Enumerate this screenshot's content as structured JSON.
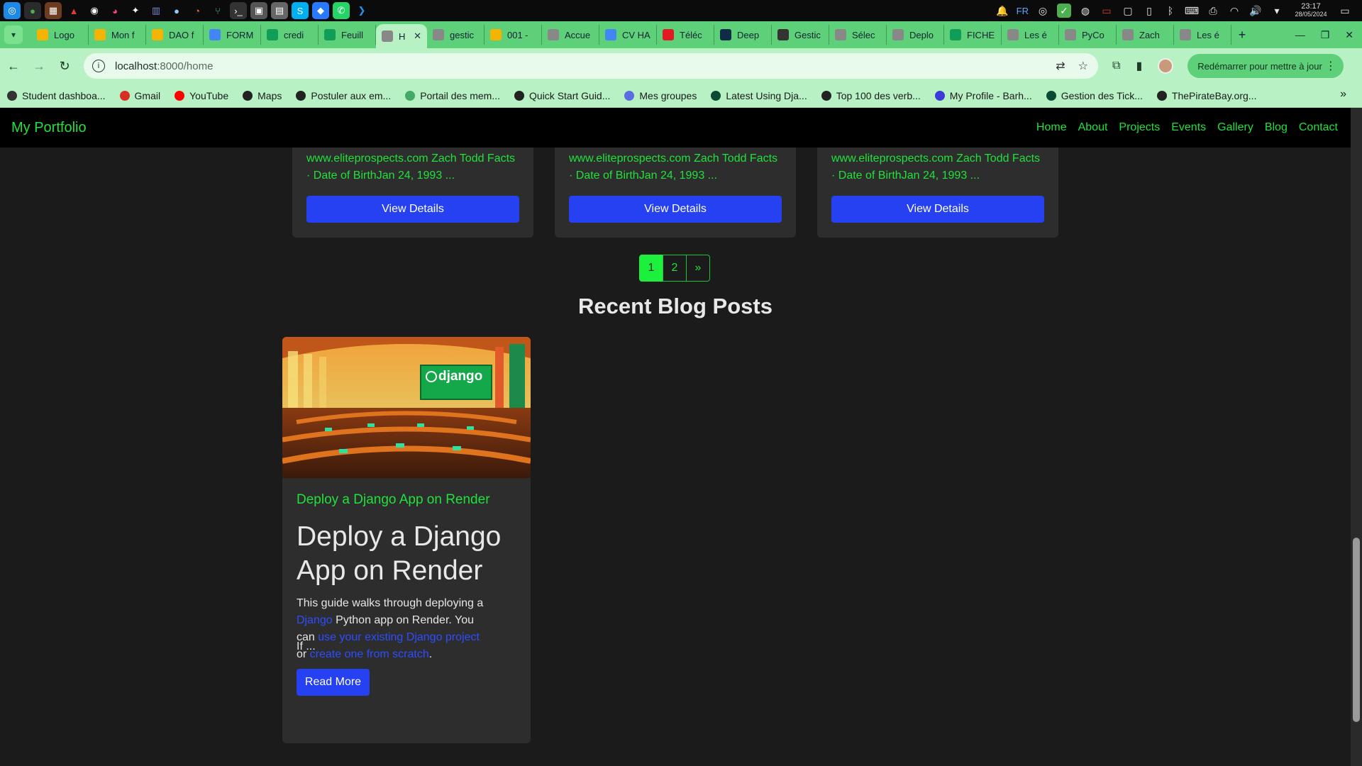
{
  "os": {
    "tray": {
      "lang": "FR"
    },
    "clock": {
      "time": "23:17",
      "date": "28/05/2024"
    }
  },
  "tabs": [
    {
      "label": "Logo",
      "icon": "drive-icon",
      "color": "#f4b400"
    },
    {
      "label": "Mon f",
      "icon": "drive-icon",
      "color": "#f4b400"
    },
    {
      "label": "DAO f",
      "icon": "drive-icon",
      "color": "#f4b400"
    },
    {
      "label": "FORM",
      "icon": "docs-icon",
      "color": "#4285f4"
    },
    {
      "label": "credi",
      "icon": "sheets-icon",
      "color": "#0f9d58"
    },
    {
      "label": "Feuill",
      "icon": "sheets-icon",
      "color": "#0f9d58"
    },
    {
      "label": "H",
      "icon": "globe-icon",
      "color": "#888888",
      "active": true
    },
    {
      "label": "gestic",
      "icon": "globe-icon",
      "color": "#888888"
    },
    {
      "label": "001 -",
      "icon": "drive-icon",
      "color": "#f4b400"
    },
    {
      "label": "Accue",
      "icon": "globe-icon",
      "color": "#888888"
    },
    {
      "label": "CV HA",
      "icon": "docs-icon",
      "color": "#4285f4"
    },
    {
      "label": "Téléc",
      "icon": "heart-icon",
      "color": "#e01b24"
    },
    {
      "label": "Deep",
      "icon": "deepl-icon",
      "color": "#0f2b46"
    },
    {
      "label": "Gestic",
      "icon": "link-icon",
      "color": "#333333"
    },
    {
      "label": "Sélec",
      "icon": "globe-icon",
      "color": "#888888"
    },
    {
      "label": "Deplo",
      "icon": "globe-icon",
      "color": "#888888"
    },
    {
      "label": "FICHE",
      "icon": "sheets-icon",
      "color": "#0f9d58"
    },
    {
      "label": "Les é",
      "icon": "globe-icon",
      "color": "#888888"
    },
    {
      "label": "PyCo",
      "icon": "globe-icon",
      "color": "#888888"
    },
    {
      "label": "Zach",
      "icon": "globe-icon",
      "color": "#888888"
    },
    {
      "label": "Les é",
      "icon": "globe-icon",
      "color": "#888888"
    }
  ],
  "address": {
    "host": "localhost",
    "path": ":8000/home"
  },
  "update_button": "Redémarrer pour mettre à jour",
  "bookmarks": [
    {
      "label": "Student dashboa...",
      "color": "#333333"
    },
    {
      "label": "Gmail",
      "color": "#d93025"
    },
    {
      "label": "YouTube",
      "color": "#ff0000"
    },
    {
      "label": "Maps",
      "color": "#222222"
    },
    {
      "label": "Postuler aux em...",
      "color": "#222222"
    },
    {
      "label": "Portail des mem...",
      "color": "#4a6"
    },
    {
      "label": "Quick Start Guid...",
      "color": "#222222"
    },
    {
      "label": "Mes groupes",
      "color": "#5b6ee1"
    },
    {
      "label": "Latest Using Dja...",
      "color": "#0c4b33"
    },
    {
      "label": "Top 100 des verb...",
      "color": "#222222"
    },
    {
      "label": "My Profile - Barh...",
      "color": "#3b3bdb"
    },
    {
      "label": "Gestion des Tick...",
      "color": "#0c4b33"
    },
    {
      "label": "ThePirateBay.org...",
      "color": "#222222"
    }
  ],
  "site": {
    "brand": "My Portfolio",
    "menu": [
      "Home",
      "About",
      "Projects",
      "Events",
      "Gallery",
      "Blog",
      "Contact"
    ],
    "accent": "#22e03b",
    "button_color": "#2641f2"
  },
  "project_cards": [
    {
      "desc_line1": "www.eliteprospects.com Zach Todd Facts",
      "desc_line2": "· Date of BirthJan 24, 1993 ...",
      "button": "View Details"
    },
    {
      "desc_line1": "www.eliteprospects.com Zach Todd Facts",
      "desc_line2": "· Date of BirthJan 24, 1993 ...",
      "button": "View Details"
    },
    {
      "desc_line1": "www.eliteprospects.com Zach Todd Facts",
      "desc_line2": "· Date of BirthJan 24, 1993 ...",
      "button": "View Details"
    }
  ],
  "pagination": [
    "1",
    "2",
    "»"
  ],
  "blog_section": {
    "title": "Recent Blog Posts",
    "post": {
      "image_text": "django",
      "link_title": "Deploy a Django App on Render",
      "title": "Deploy a Django App on Render",
      "body_1": "This guide walks through deploying a ",
      "link_1": "Django",
      "body_2": " Python app on Render. You can ",
      "link_2": "use your existing Django project",
      "body_3": " or ",
      "link_3": "create one from scratch",
      "body_4": ".",
      "more": "If ...",
      "button": "Read More"
    }
  }
}
